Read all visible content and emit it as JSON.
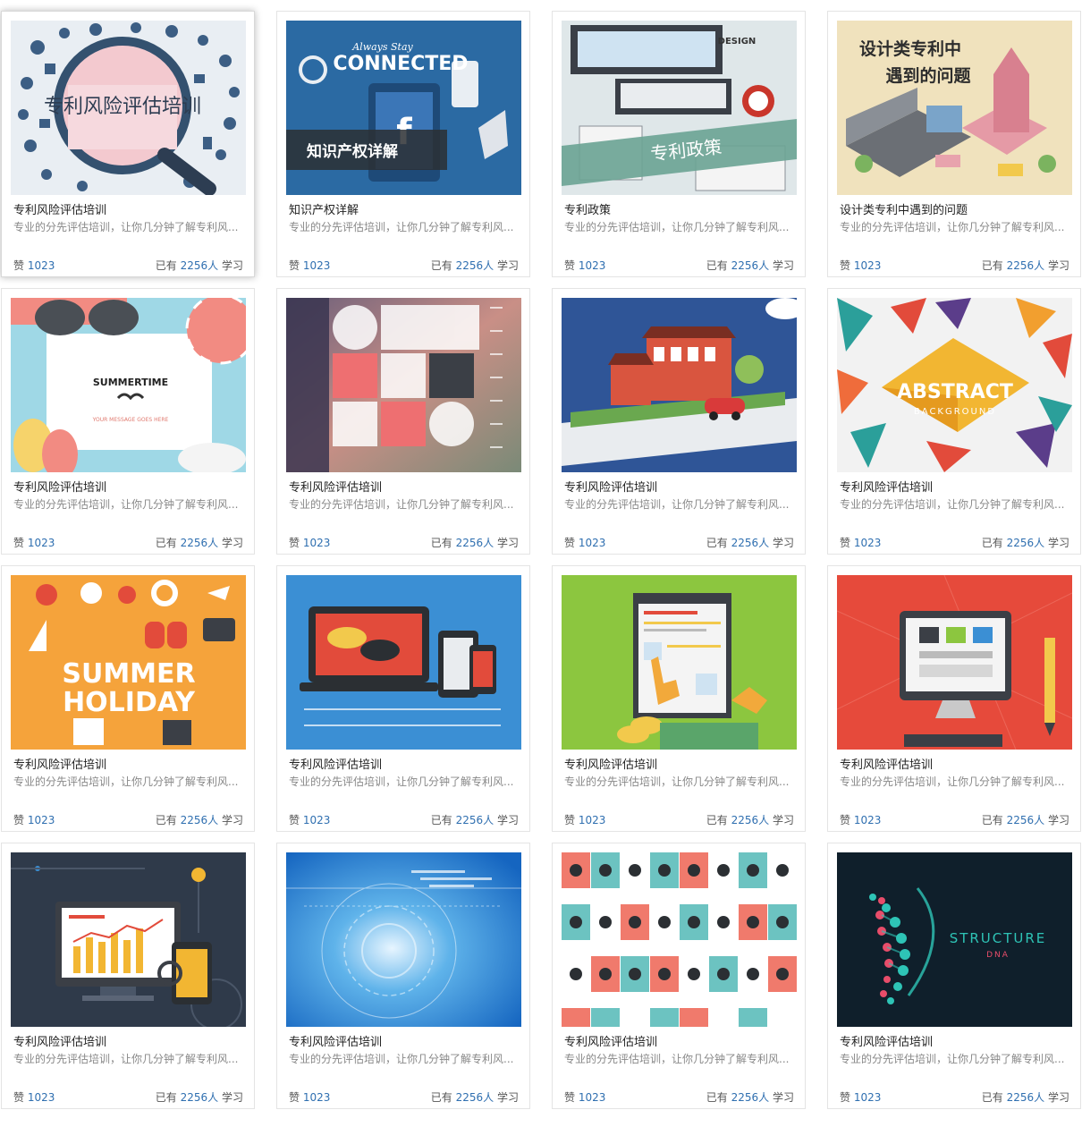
{
  "courses": [
    {
      "title": "专利风险评估培训",
      "desc": "专业的分先评估培训，让你几分钟了解专利风...",
      "likes_label": "赞",
      "likes": "1023",
      "learners_prefix": "已有",
      "learners": "2256人",
      "learners_suffix": "学习",
      "overlay": "专利风险评估培训"
    },
    {
      "title": "知识产权详解",
      "desc": "专业的分先评估培训，让你几分钟了解专利风...",
      "likes_label": "赞",
      "likes": "1023",
      "learners_prefix": "已有",
      "learners": "2256人",
      "learners_suffix": "学习",
      "overlay": "知识产权详解",
      "overlay2": "Always Stay",
      "overlay3": "CONNECTED"
    },
    {
      "title": "专利政策",
      "desc": "专业的分先评估培训，让你几分钟了解专利风...",
      "likes_label": "赞",
      "likes": "1023",
      "learners_prefix": "已有",
      "learners": "2256人",
      "learners_suffix": "学习",
      "overlay": "专利政策",
      "overlay2": "DESIGN"
    },
    {
      "title": "设计类专利中遇到的问题",
      "desc": "专业的分先评估培训，让你几分钟了解专利风...",
      "likes_label": "赞",
      "likes": "1023",
      "learners_prefix": "已有",
      "learners": "2256人",
      "learners_suffix": "学习",
      "overlay": "设计类专利中",
      "overlay2": "遇到的问题"
    },
    {
      "title": "专利风险评估培训",
      "desc": "专业的分先评估培训，让你几分钟了解专利风...",
      "likes_label": "赞",
      "likes": "1023",
      "learners_prefix": "已有",
      "learners": "2256人",
      "learners_suffix": "学习",
      "overlay": "SUMMERTIME",
      "overlay2": "YOUR MESSAGE GOES HERE"
    },
    {
      "title": "专利风险评估培训",
      "desc": "专业的分先评估培训，让你几分钟了解专利风...",
      "likes_label": "赞",
      "likes": "1023",
      "learners_prefix": "已有",
      "learners": "2256人",
      "learners_suffix": "学习"
    },
    {
      "title": "专利风险评估培训",
      "desc": "专业的分先评估培训，让你几分钟了解专利风...",
      "likes_label": "赞",
      "likes": "1023",
      "learners_prefix": "已有",
      "learners": "2256人",
      "learners_suffix": "学习"
    },
    {
      "title": "专利风险评估培训",
      "desc": "专业的分先评估培训，让你几分钟了解专利风...",
      "likes_label": "赞",
      "likes": "1023",
      "learners_prefix": "已有",
      "learners": "2256人",
      "learners_suffix": "学习",
      "overlay": "ABSTRACT",
      "overlay2": "BACKGROUND"
    },
    {
      "title": "专利风险评估培训",
      "desc": "专业的分先评估培训，让你几分钟了解专利风...",
      "likes_label": "赞",
      "likes": "1023",
      "learners_prefix": "已有",
      "learners": "2256人",
      "learners_suffix": "学习",
      "overlay": "SUMMER",
      "overlay2": "HOLIDAY"
    },
    {
      "title": "专利风险评估培训",
      "desc": "专业的分先评估培训，让你几分钟了解专利风...",
      "likes_label": "赞",
      "likes": "1023",
      "learners_prefix": "已有",
      "learners": "2256人",
      "learners_suffix": "学习"
    },
    {
      "title": "专利风险评估培训",
      "desc": "专业的分先评估培训，让你几分钟了解专利风...",
      "likes_label": "赞",
      "likes": "1023",
      "learners_prefix": "已有",
      "learners": "2256人",
      "learners_suffix": "学习"
    },
    {
      "title": "专利风险评估培训",
      "desc": "专业的分先评估培训，让你几分钟了解专利风...",
      "likes_label": "赞",
      "likes": "1023",
      "learners_prefix": "已有",
      "learners": "2256人",
      "learners_suffix": "学习"
    },
    {
      "title": "专利风险评估培训",
      "desc": "专业的分先评估培训，让你几分钟了解专利风...",
      "likes_label": "赞",
      "likes": "1023",
      "learners_prefix": "已有",
      "learners": "2256人",
      "learners_suffix": "学习"
    },
    {
      "title": "专利风险评估培训",
      "desc": "专业的分先评估培训，让你几分钟了解专利风...",
      "likes_label": "赞",
      "likes": "1023",
      "learners_prefix": "已有",
      "learners": "2256人",
      "learners_suffix": "学习"
    },
    {
      "title": "专利风险评估培训",
      "desc": "专业的分先评估培训，让你几分钟了解专利风...",
      "likes_label": "赞",
      "likes": "1023",
      "learners_prefix": "已有",
      "learners": "2256人",
      "learners_suffix": "学习"
    },
    {
      "title": "专利风险评估培训",
      "desc": "专业的分先评估培训，让你几分钟了解专利风...",
      "likes_label": "赞",
      "likes": "1023",
      "learners_prefix": "已有",
      "learners": "2256人",
      "learners_suffix": "学习",
      "overlay": "STRUCTURE",
      "overlay2": "DNA"
    }
  ],
  "colors": {
    "accent_number": "#2f6fb0",
    "title_text": "#222222",
    "desc_text": "#888888",
    "card_border": "#e4e4e4"
  }
}
